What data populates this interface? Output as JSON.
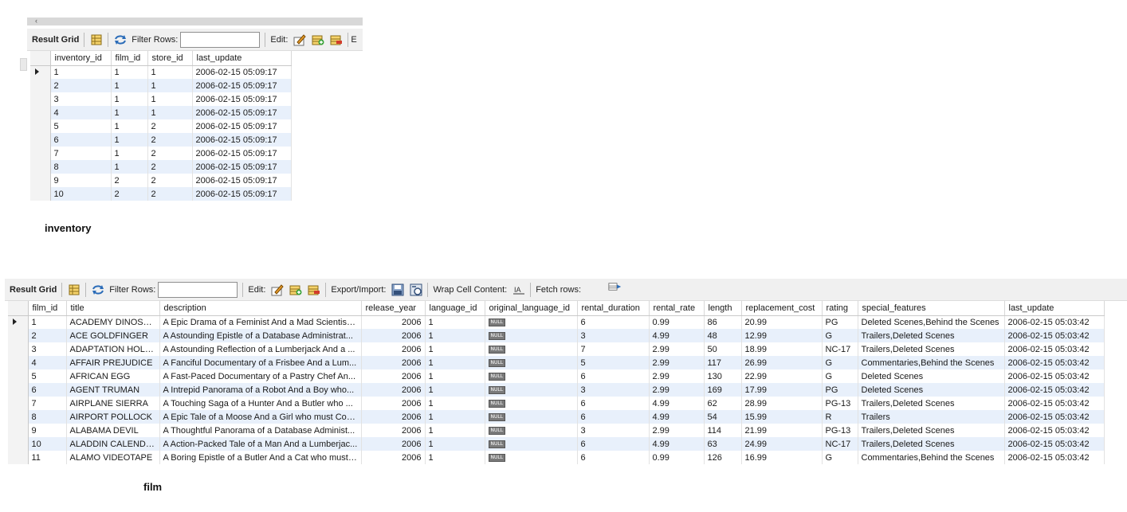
{
  "inventory": {
    "caption": "inventory",
    "toolbar": {
      "result_grid": "Result Grid",
      "filter_rows": "Filter Rows:",
      "edit": "Edit:",
      "cut_label": "E"
    },
    "columns": [
      "inventory_id",
      "film_id",
      "store_id",
      "last_update"
    ],
    "rows": [
      [
        "1",
        "1",
        "1",
        "2006-02-15 05:09:17"
      ],
      [
        "2",
        "1",
        "1",
        "2006-02-15 05:09:17"
      ],
      [
        "3",
        "1",
        "1",
        "2006-02-15 05:09:17"
      ],
      [
        "4",
        "1",
        "1",
        "2006-02-15 05:09:17"
      ],
      [
        "5",
        "1",
        "2",
        "2006-02-15 05:09:17"
      ],
      [
        "6",
        "1",
        "2",
        "2006-02-15 05:09:17"
      ],
      [
        "7",
        "1",
        "2",
        "2006-02-15 05:09:17"
      ],
      [
        "8",
        "1",
        "2",
        "2006-02-15 05:09:17"
      ],
      [
        "9",
        "2",
        "2",
        "2006-02-15 05:09:17"
      ],
      [
        "10",
        "2",
        "2",
        "2006-02-15 05:09:17"
      ]
    ]
  },
  "film": {
    "caption": "film",
    "toolbar": {
      "result_grid": "Result Grid",
      "filter_rows": "Filter Rows:",
      "edit": "Edit:",
      "export_import": "Export/Import:",
      "wrap_cell": "Wrap Cell Content:",
      "fetch_rows": "Fetch rows:"
    },
    "null_badge": "NULL",
    "columns": [
      "film_id",
      "title",
      "description",
      "release_year",
      "language_id",
      "original_language_id",
      "rental_duration",
      "rental_rate",
      "length",
      "replacement_cost",
      "rating",
      "special_features",
      "last_update"
    ],
    "rows": [
      [
        "1",
        "ACADEMY DINOSAUR",
        "A Epic Drama of a Feminist And a Mad Scientist ...",
        "2006",
        "1",
        "NULL",
        "6",
        "0.99",
        "86",
        "20.99",
        "PG",
        "Deleted Scenes,Behind the Scenes",
        "2006-02-15 05:03:42"
      ],
      [
        "2",
        "ACE GOLDFINGER",
        "A Astounding Epistle of a Database Administrat...",
        "2006",
        "1",
        "NULL",
        "3",
        "4.99",
        "48",
        "12.99",
        "G",
        "Trailers,Deleted Scenes",
        "2006-02-15 05:03:42"
      ],
      [
        "3",
        "ADAPTATION HOLES",
        "A Astounding Reflection of a Lumberjack And a ...",
        "2006",
        "1",
        "NULL",
        "7",
        "2.99",
        "50",
        "18.99",
        "NC-17",
        "Trailers,Deleted Scenes",
        "2006-02-15 05:03:42"
      ],
      [
        "4",
        "AFFAIR PREJUDICE",
        "A Fanciful Documentary of a Frisbee And a Lum...",
        "2006",
        "1",
        "NULL",
        "5",
        "2.99",
        "117",
        "26.99",
        "G",
        "Commentaries,Behind the Scenes",
        "2006-02-15 05:03:42"
      ],
      [
        "5",
        "AFRICAN EGG",
        "A Fast-Paced Documentary of a Pastry Chef An...",
        "2006",
        "1",
        "NULL",
        "6",
        "2.99",
        "130",
        "22.99",
        "G",
        "Deleted Scenes",
        "2006-02-15 05:03:42"
      ],
      [
        "6",
        "AGENT TRUMAN",
        "A Intrepid Panorama of a Robot And a Boy who...",
        "2006",
        "1",
        "NULL",
        "3",
        "2.99",
        "169",
        "17.99",
        "PG",
        "Deleted Scenes",
        "2006-02-15 05:03:42"
      ],
      [
        "7",
        "AIRPLANE SIERRA",
        "A Touching Saga of a Hunter And a Butler who ...",
        "2006",
        "1",
        "NULL",
        "6",
        "4.99",
        "62",
        "28.99",
        "PG-13",
        "Trailers,Deleted Scenes",
        "2006-02-15 05:03:42"
      ],
      [
        "8",
        "AIRPORT POLLOCK",
        "A Epic Tale of a Moose And a Girl who must Con...",
        "2006",
        "1",
        "NULL",
        "6",
        "4.99",
        "54",
        "15.99",
        "R",
        "Trailers",
        "2006-02-15 05:03:42"
      ],
      [
        "9",
        "ALABAMA DEVIL",
        "A Thoughtful Panorama of a Database Administ...",
        "2006",
        "1",
        "NULL",
        "3",
        "2.99",
        "114",
        "21.99",
        "PG-13",
        "Trailers,Deleted Scenes",
        "2006-02-15 05:03:42"
      ],
      [
        "10",
        "ALADDIN CALENDAR",
        "A Action-Packed Tale of a Man And a Lumberjac...",
        "2006",
        "1",
        "NULL",
        "6",
        "4.99",
        "63",
        "24.99",
        "NC-17",
        "Trailers,Deleted Scenes",
        "2006-02-15 05:03:42"
      ],
      [
        "11",
        "ALAMO VIDEOTAPE",
        "A Boring Epistle of a Butler And a Cat who must ...",
        "2006",
        "1",
        "NULL",
        "6",
        "0.99",
        "126",
        "16.99",
        "G",
        "Commentaries,Behind the Scenes",
        "2006-02-15 05:03:42"
      ]
    ]
  },
  "colors": {
    "toolbar_bg": "#f0f0f0",
    "row_alt": "#e8f0fb",
    "gutter": "#f3f3f3",
    "null_badge": "#7a7a7a"
  },
  "icons": [
    "grid-view-icon",
    "refresh-icon",
    "edit-row-icon",
    "insert-row-icon",
    "delete-row-icon",
    "export-icon",
    "import-icon",
    "wrap-cell-icon",
    "fetch-rows-icon",
    "row-pointer-icon"
  ]
}
